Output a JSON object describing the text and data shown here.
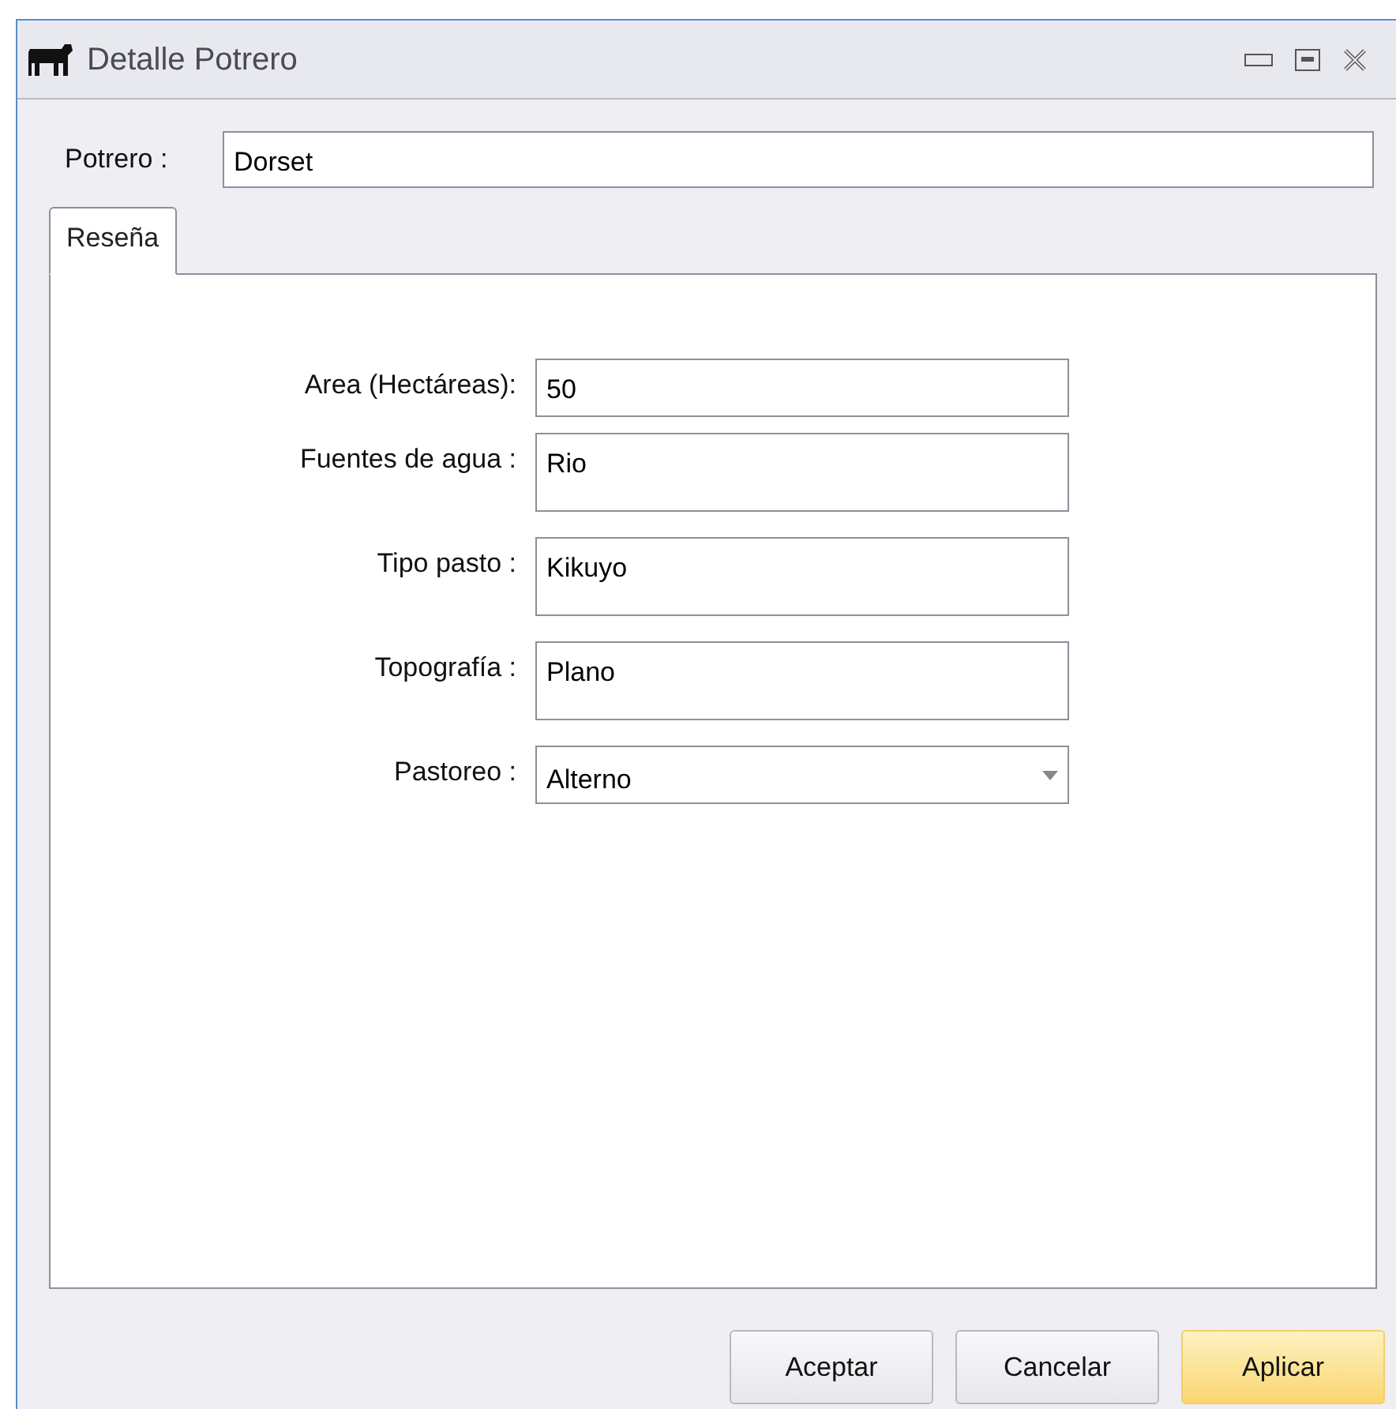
{
  "window": {
    "title": "Detalle Potrero"
  },
  "potrero": {
    "label": "Potrero :",
    "value": "Dorset"
  },
  "tabs": [
    {
      "label": "Reseña",
      "selected": true
    }
  ],
  "fields": [
    {
      "kind": "text",
      "label": "Area (Hectáreas):",
      "value": "50"
    },
    {
      "kind": "multiline",
      "label": "Fuentes de agua :",
      "value": "Rio"
    },
    {
      "kind": "multiline",
      "label": "Tipo pasto :",
      "value": "Kikuyo"
    },
    {
      "kind": "multiline",
      "label": "Topografía :",
      "value": "Plano"
    },
    {
      "kind": "dropdown",
      "label": "Pastoreo :",
      "value": "Alterno"
    }
  ],
  "buttons": [
    {
      "label": "Aceptar",
      "highlighted": false
    },
    {
      "label": "Cancelar",
      "highlighted": false
    },
    {
      "label": "Aplicar",
      "highlighted": true
    }
  ]
}
